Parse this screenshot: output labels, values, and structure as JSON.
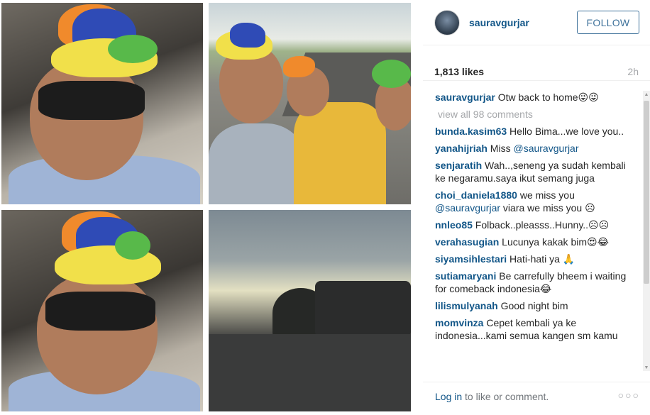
{
  "post": {
    "username": "sauravgurjar",
    "follow_label": "FOLLOW",
    "likes": "1,813 likes",
    "time": "2h",
    "view_all": "view all 98 comments",
    "login_link": "Log in",
    "login_rest": " to like or comment.",
    "more_icon": "more-options-icon"
  },
  "comments": [
    {
      "user": "sauravgurjar",
      "text": " Otw back to home😜😜"
    },
    {
      "user": "bunda.kasim63",
      "text": " Hello Bima...we love you.."
    },
    {
      "user": "yanahijriah",
      "text": " Miss ",
      "mention": "@sauravgurjar"
    },
    {
      "user": "senjaratih",
      "text": " Wah..,seneng ya sudah kembali ke negaramu.saya ikut semang juga"
    },
    {
      "user": "choi_daniela1880",
      "text": " we miss you ",
      "mention": "@sauravgurjar",
      "text2": " viara we miss you ☹"
    },
    {
      "user": "nnleo85",
      "text": " Folback..pleasss..Hunny..☹☹"
    },
    {
      "user": "verahasugian",
      "text": " Lucunya kakak bim😍😂"
    },
    {
      "user": "siyamsihlestari",
      "text": " Hati-hati ya 🙏"
    },
    {
      "user": "sutiamaryani",
      "text": " Be carrefully bheem i waiting for comeback indonesia😂"
    },
    {
      "user": "lilismulyanah",
      "text": " Good night bim"
    },
    {
      "user": "momvinza",
      "text": " Cepet kembali ya ke indonesia...kami semua kangen sm kamu"
    }
  ]
}
